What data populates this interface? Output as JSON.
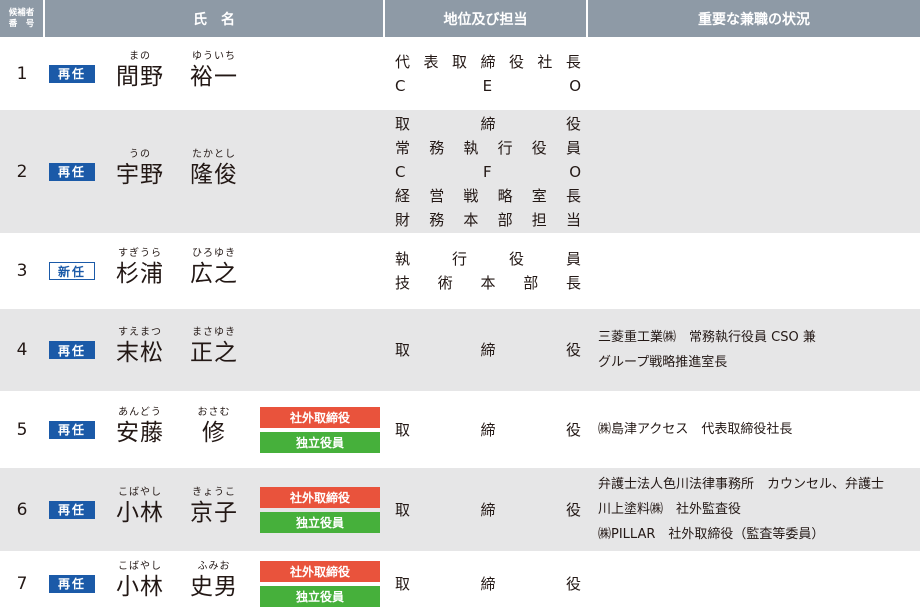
{
  "headers": {
    "number": [
      "候補者",
      "番　号"
    ],
    "name": "氏　名",
    "position": "地位及び担当",
    "concurrent": "重要な兼職の状況"
  },
  "tags": {
    "outside": "社外取締役",
    "independent": "独立役員"
  },
  "candidates": [
    {
      "no": "1",
      "status": "再任",
      "status_type": "reappointment",
      "surname": "間野",
      "surname_ruby": "まの",
      "given": "裕一",
      "given_ruby": "ゆういち",
      "outside_tags": false,
      "positions": [
        "代表取締役社長",
        "CEO"
      ],
      "concurrent": []
    },
    {
      "no": "2",
      "status": "再任",
      "status_type": "reappointment",
      "surname": "宇野",
      "surname_ruby": "うの",
      "given": "隆俊",
      "given_ruby": "たかとし",
      "outside_tags": false,
      "positions": [
        "取締役",
        "常務執行役員",
        "CFO",
        "経営戦略室長",
        "財務本部担当"
      ],
      "concurrent": []
    },
    {
      "no": "3",
      "status": "新任",
      "status_type": "new",
      "surname": "杉浦",
      "surname_ruby": "すぎうら",
      "given": "広之",
      "given_ruby": "ひろゆき",
      "outside_tags": false,
      "positions": [
        "執行役員",
        "技術本部長"
      ],
      "concurrent": []
    },
    {
      "no": "4",
      "status": "再任",
      "status_type": "reappointment",
      "surname": "末松",
      "surname_ruby": "すえまつ",
      "given": "正之",
      "given_ruby": "まさゆき",
      "outside_tags": false,
      "positions": [
        "取締役"
      ],
      "concurrent": [
        "三菱重工業㈱　常務執行役員 CSO 兼",
        "グループ戦略推進室長"
      ]
    },
    {
      "no": "5",
      "status": "再任",
      "status_type": "reappointment",
      "surname": "安藤",
      "surname_ruby": "あんどう",
      "given": "修",
      "given_ruby": "おさむ",
      "outside_tags": true,
      "positions": [
        "取締役"
      ],
      "concurrent": [
        "㈱島津アクセス　代表取締役社長"
      ]
    },
    {
      "no": "6",
      "status": "再任",
      "status_type": "reappointment",
      "surname": "小林",
      "surname_ruby": "こばやし",
      "given": "京子",
      "given_ruby": "きょうこ",
      "outside_tags": true,
      "positions": [
        "取締役"
      ],
      "concurrent": [
        "弁護士法人色川法律事務所　カウンセル、弁護士",
        "川上塗料㈱　社外監査役",
        "㈱PILLAR　社外取締役（監査等委員）"
      ]
    },
    {
      "no": "7",
      "status": "再任",
      "status_type": "reappointment",
      "surname": "小林",
      "surname_ruby": "こばやし",
      "given": "史男",
      "given_ruby": "ふみお",
      "outside_tags": true,
      "positions": [
        "取締役"
      ],
      "concurrent": []
    }
  ],
  "colors": {
    "header_bg": "#8e9aa6",
    "row_shade": "#e6e6e7",
    "badge_blue": "#1b5aa8",
    "tag_red": "#e9533c",
    "tag_green": "#46b03b"
  }
}
